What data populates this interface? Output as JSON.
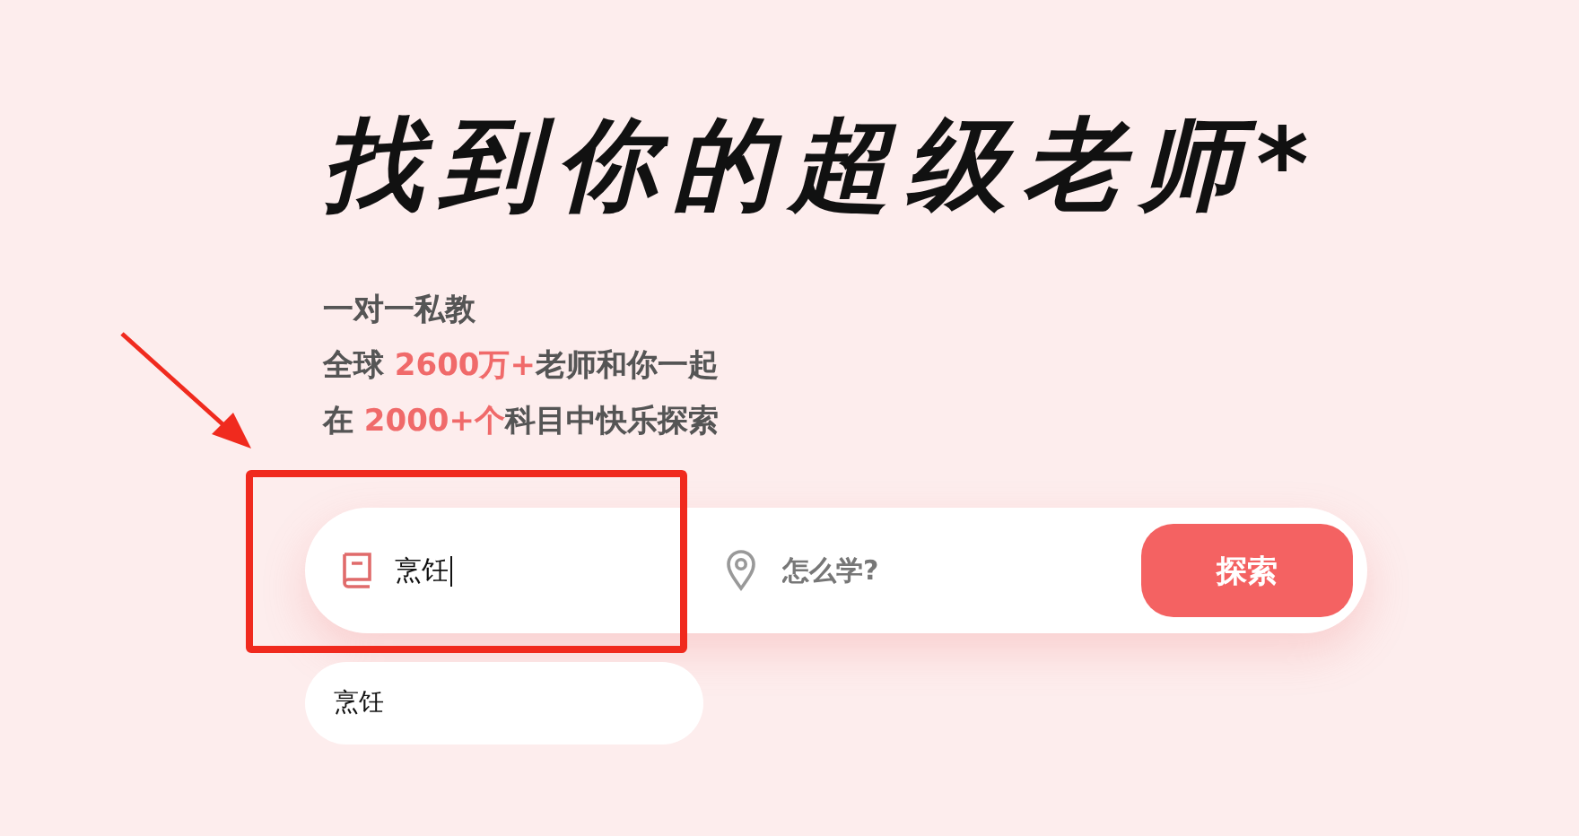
{
  "headline": "找到你的超级老师*",
  "intro_lines": [
    {
      "segments": [
        {
          "text": "一对一私教",
          "highlight": false
        }
      ]
    },
    {
      "segments": [
        {
          "text": "全球 ",
          "highlight": false
        },
        {
          "text": "2600万+",
          "highlight": true
        },
        {
          "text": "老师和你一起",
          "highlight": false
        }
      ]
    },
    {
      "segments": [
        {
          "text": "在 ",
          "highlight": false
        },
        {
          "text": "2000+个",
          "highlight": true
        },
        {
          "text": "科目中快乐探索",
          "highlight": false
        }
      ]
    }
  ],
  "search": {
    "subject_value": "烹饪",
    "location_placeholder": "怎么学?",
    "button": "探索"
  },
  "suggestions": [
    {
      "text": "烹饪"
    }
  ]
}
